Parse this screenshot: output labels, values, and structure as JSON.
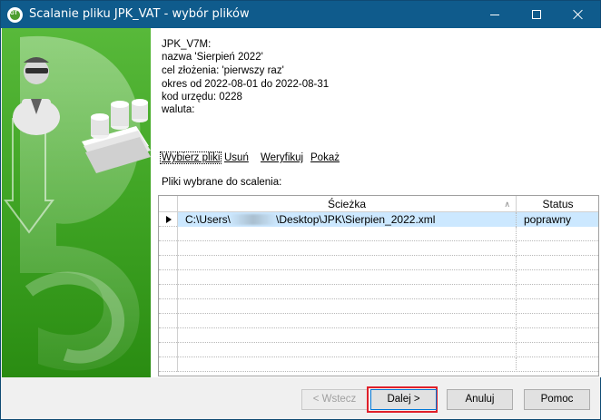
{
  "window": {
    "title": "Scalanie pliku JPK_VAT - wybór plików"
  },
  "info": {
    "lines": [
      "JPK_V7M:",
      "nazwa 'Sierpień 2022'",
      "cel złożenia: 'pierwszy raz'",
      "okres od 2022-08-01 do 2022-08-31",
      "kod urzędu: 0228",
      "waluta:"
    ]
  },
  "toolbar": {
    "choose_files": "Wybierz pliki",
    "remove": "Usuń",
    "verify": "Weryfikuj",
    "show": "Pokaż"
  },
  "files_label": "Pliki wybrane do scalenia:",
  "grid": {
    "columns": [
      "Ścieżka",
      "Status"
    ],
    "rows": [
      {
        "path_prefix": "C:\\Users\\",
        "path_suffix": "\\Desktop\\JPK\\Sierpien_2022.xml",
        "status": "poprawny"
      }
    ]
  },
  "buttons": {
    "back": "< Wstecz",
    "next": "Dalej >",
    "cancel": "Anuluj",
    "help": "Pomoc"
  },
  "colors": {
    "titlebar": "#0f5b8c",
    "sidebar": "#3fa424",
    "selected_row": "#cce8ff",
    "highlight": "#e0202a"
  }
}
